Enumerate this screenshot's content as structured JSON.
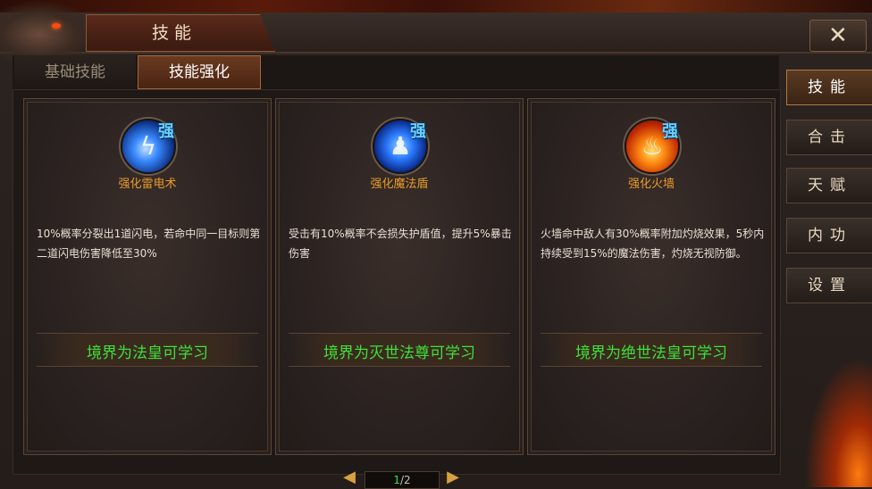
{
  "window": {
    "title": "技能",
    "close_icon": "close-icon"
  },
  "tabs": [
    {
      "label": "基础技能",
      "active": false
    },
    {
      "label": "技能强化",
      "active": true
    }
  ],
  "skills": [
    {
      "icon": "thunder-icon",
      "badge": "强",
      "name": "强化雷电术",
      "description": "10%概率分裂出1道闪电，若命中同一目标则第二道闪电伤害降低至30%",
      "requirement": "境界为法皇可学习"
    },
    {
      "icon": "magic-shield-icon",
      "badge": "强",
      "name": "强化魔法盾",
      "description": "受击有10%概率不会损失护盾值，提升5%暴击伤害",
      "requirement": "境界为灭世法尊可学习"
    },
    {
      "icon": "fire-wall-icon",
      "badge": "强",
      "name": "强化火墙",
      "description": "火墙命中敌人有30%概率附加灼烧效果，5秒内持续受到15%的魔法伤害，灼烧无视防御。",
      "requirement": "境界为绝世法皇可学习"
    }
  ],
  "side_menu": [
    {
      "label": "技能",
      "active": true
    },
    {
      "label": "合击",
      "active": false
    },
    {
      "label": "天赋",
      "active": false
    },
    {
      "label": "内功",
      "active": false
    },
    {
      "label": "设置",
      "active": false
    }
  ],
  "pager": {
    "current": "1",
    "separator": "/",
    "total": "2"
  },
  "colors": {
    "skill_name": "#e89a2a",
    "requirement": "#3ee03a",
    "badge": "#6ad0ff"
  }
}
